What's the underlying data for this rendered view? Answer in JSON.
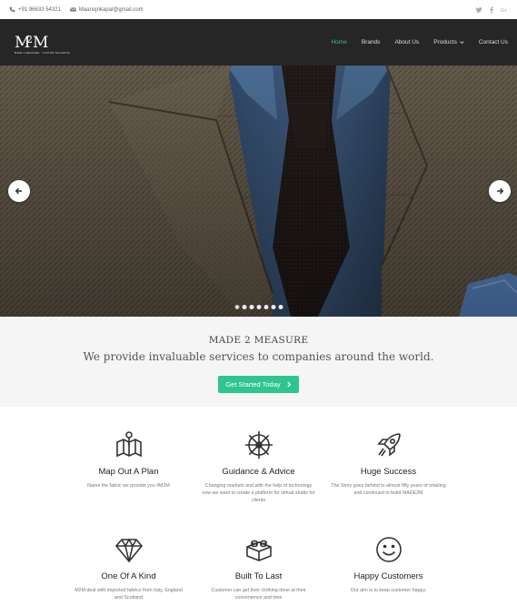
{
  "topbar": {
    "phone": "+91 96633 54321",
    "email": "Maanojnkapal@gmail.com",
    "social": [
      "twitter-icon",
      "facebook-icon",
      "google-plus-icon"
    ]
  },
  "brand": {
    "logo_text": "M2M",
    "tagline": "MADE 2 MEASURE · CUSTOM TAILORING"
  },
  "nav": {
    "items": [
      {
        "label": "Home",
        "active": true
      },
      {
        "label": "Brands"
      },
      {
        "label": "About Us"
      },
      {
        "label": "Products",
        "dropdown": true
      },
      {
        "label": "Contact Us"
      }
    ]
  },
  "slider": {
    "slide_count": 7,
    "active_index": 0
  },
  "cta": {
    "title": "MADE 2 MEASURE",
    "subtitle": "We provide invaluable services to companies around the world.",
    "button_label": "Get Started Today"
  },
  "features": [
    {
      "icon": "map-icon",
      "title": "Map Out A Plan",
      "text": "Name the fabric we provide you #M2M"
    },
    {
      "icon": "ship-wheel-icon",
      "title": "Guidance & Advice",
      "text": "Changing markets and with the help of technology now we want to create a platform for virtual studio for clients"
    },
    {
      "icon": "rocket-icon",
      "title": "Huge Success",
      "text": "The Story goes behind to almost fifty years of retailing and continued to build MADE2M"
    },
    {
      "icon": "diamond-icon",
      "title": "One Of A Kind",
      "text": "M2M deal with imported fabrics from Italy, England and Scotland"
    },
    {
      "icon": "lego-brick-icon",
      "title": "Built To Last",
      "text": "Customer can get their clothing done at their convenience and time"
    },
    {
      "icon": "smiley-icon",
      "title": "Happy Customers",
      "text": "Our aim is to keep customer happy."
    }
  ],
  "colors": {
    "accent": "#2ec58f",
    "nav_bg": "#262626",
    "cta_bg": "#f5f5f5"
  }
}
